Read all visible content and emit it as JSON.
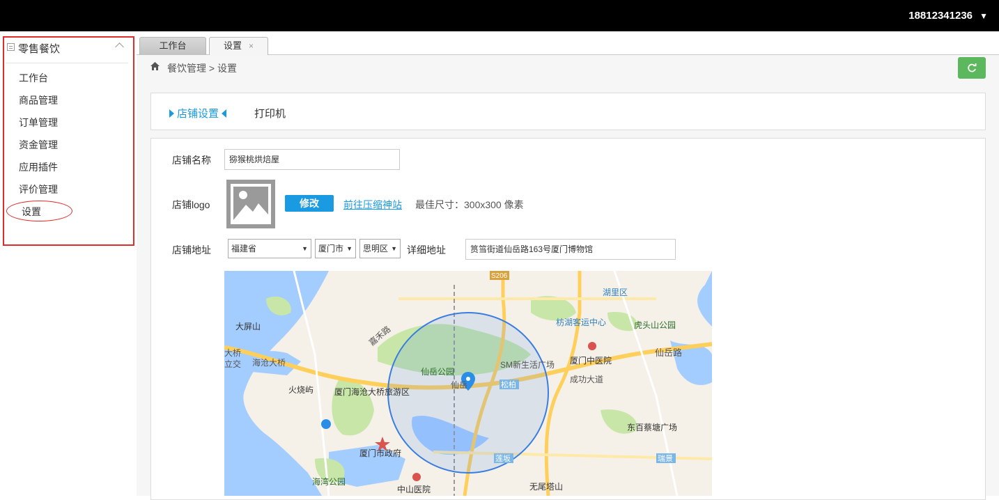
{
  "header": {
    "user_phone": "18812341236",
    "user_caret": "▼"
  },
  "sidebar": {
    "group_label": "零售餐饮",
    "items": [
      {
        "label": "工作台"
      },
      {
        "label": "商品管理"
      },
      {
        "label": "订单管理"
      },
      {
        "label": "资金管理"
      },
      {
        "label": "应用插件"
      },
      {
        "label": "评价管理"
      },
      {
        "label": "设置"
      }
    ]
  },
  "tabs": [
    {
      "label": "工作台"
    },
    {
      "label": "设置",
      "close": "×"
    }
  ],
  "breadcrumb": {
    "text": "餐饮管理  >  设置"
  },
  "subtabs": {
    "active": "店铺设置",
    "other": "打印机"
  },
  "form": {
    "shop_name_label": "店铺名称",
    "shop_name_value": "猕猴桃烘焙屋",
    "logo_label": "店铺logo",
    "edit_button": "修改",
    "compress_link": "前往压缩神站",
    "size_hint": "最佳尺寸：300x300 像素",
    "address_label": "店铺地址",
    "province": "福建省",
    "city": "厦门市",
    "district": "思明区",
    "detail_label": "详细地址",
    "detail_value": "筼筜街道仙岳路163号厦门博物馆"
  },
  "map": {
    "labels": {
      "s206": "S206",
      "huli": "湖里区",
      "fanghu": "枋湖客运中心",
      "hutou": "虎头山公园",
      "dapingshan": "大屏山",
      "xianyue_rd": "仙岳路",
      "xmzyy": "厦门中医院",
      "sm": "SM新生活广场",
      "xianyue_park": "仙岳公园",
      "songbai": "松柏",
      "chenggong": "成功大道",
      "haicang_bridge": "海沧大桥",
      "huoshaoyu": "火烧屿",
      "haicang_tour": "厦门海沧大桥旅游区",
      "dongbai": "东百蔡塘广场",
      "xmgov": "厦门市政府",
      "lianban": "莲坂",
      "ruijing": "瑞景",
      "haiwan": "海湾公园",
      "zhongshan": "中山医院",
      "wuweita": "无尾塔山",
      "bridge_left": "大桥",
      "jiao": "立交",
      "xianyue_short": "仙岳",
      "jiahe": "嘉禾路"
    }
  }
}
